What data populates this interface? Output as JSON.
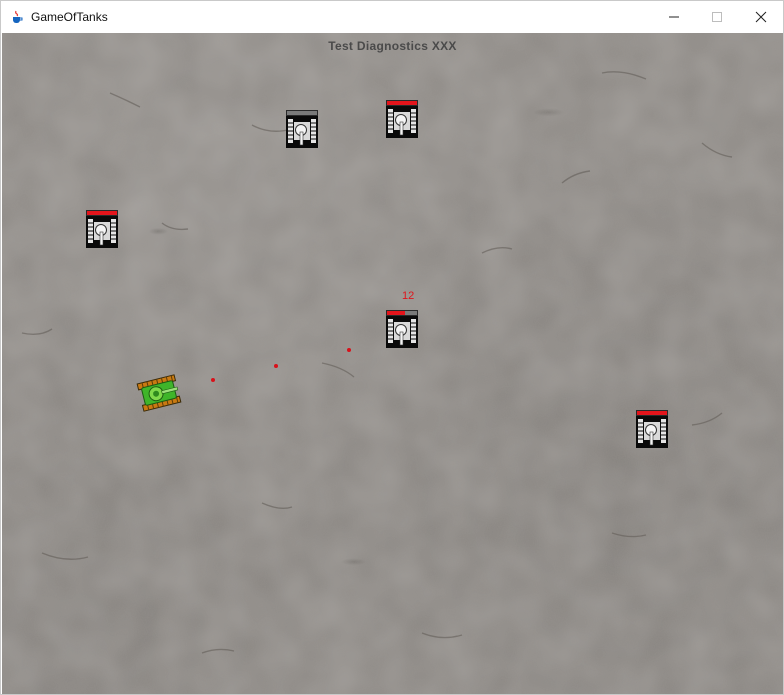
{
  "window": {
    "title": "GameOfTanks",
    "app_icon": "java-cup-icon",
    "controls": [
      "minimize-icon",
      "maximize-icon",
      "close-icon"
    ]
  },
  "game": {
    "diagnostics": "Test Diagnostics XXX",
    "enemies": [
      {
        "id": 1,
        "health_fraction": 0.0
      },
      {
        "id": 2,
        "health_fraction": 1.0
      },
      {
        "id": 3,
        "health_fraction": 1.0
      },
      {
        "id": 4,
        "health_fraction": 0.6,
        "hp_label": "12"
      },
      {
        "id": 5,
        "health_fraction": 1.0
      }
    ],
    "colors": {
      "ground": "#8f8b87",
      "health": "#e4141b",
      "health_empty": "#7a7a7a",
      "bullet": "#d8111a",
      "player_tank": "#3fb52a",
      "enemy_tank": "#d9d9d9"
    },
    "bullets_visible": 3,
    "player": {
      "icon": "green-tank-icon"
    }
  }
}
